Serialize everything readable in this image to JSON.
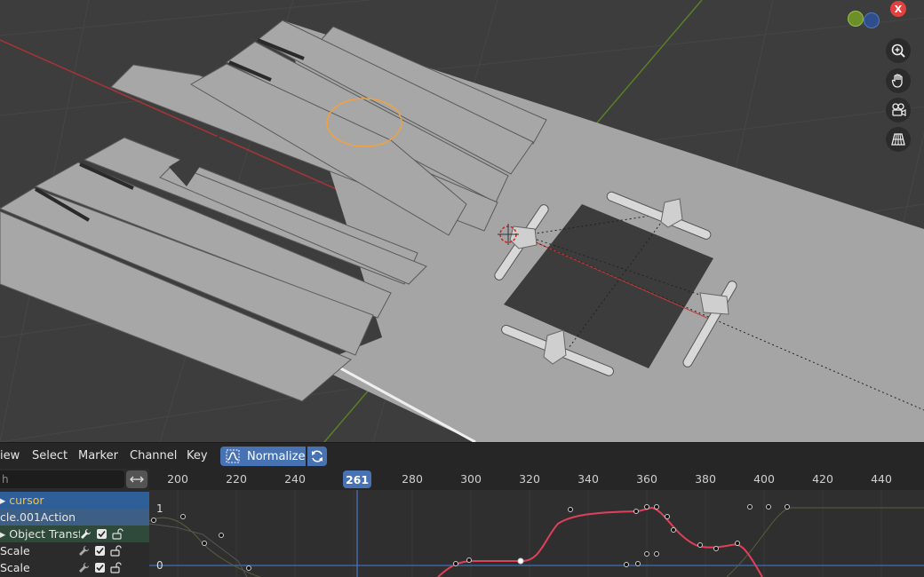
{
  "viewport": {
    "axis_x_label": "X",
    "nav_icons": [
      "zoom-icon",
      "pan-hand-icon",
      "camera-view-icon",
      "perspective-grid-icon"
    ],
    "colors": {
      "selection_outline": "#f2a13c",
      "x_axis": "#c9393b",
      "y_axis": "#6e9b2d",
      "object": "#a3a3a3"
    }
  },
  "graph_editor": {
    "menu": {
      "view": "iew",
      "select": "Select",
      "marker": "Marker",
      "channel": "Channel",
      "key": "Key"
    },
    "normalize_label": "Normalize",
    "search_placeholder": "h",
    "channels": [
      {
        "label": "cursor",
        "type": "object"
      },
      {
        "label": "cle.001Action",
        "type": "action"
      },
      {
        "label": "Object Transfo",
        "type": "group"
      },
      {
        "label": "Scale",
        "type": "fcurve"
      },
      {
        "label": "Scale",
        "type": "fcurve"
      }
    ],
    "timeline": {
      "ticks": [
        "200",
        "220",
        "240",
        "260",
        "280",
        "300",
        "320",
        "340",
        "360",
        "380",
        "400",
        "420",
        "440"
      ],
      "current_frame": "261"
    },
    "y_labels": {
      "top": "1",
      "bottom": "0"
    },
    "colors": {
      "accent": "#4772b3",
      "curve_active": "#e0405a",
      "curve_inactive": "#6b6a3a"
    }
  }
}
